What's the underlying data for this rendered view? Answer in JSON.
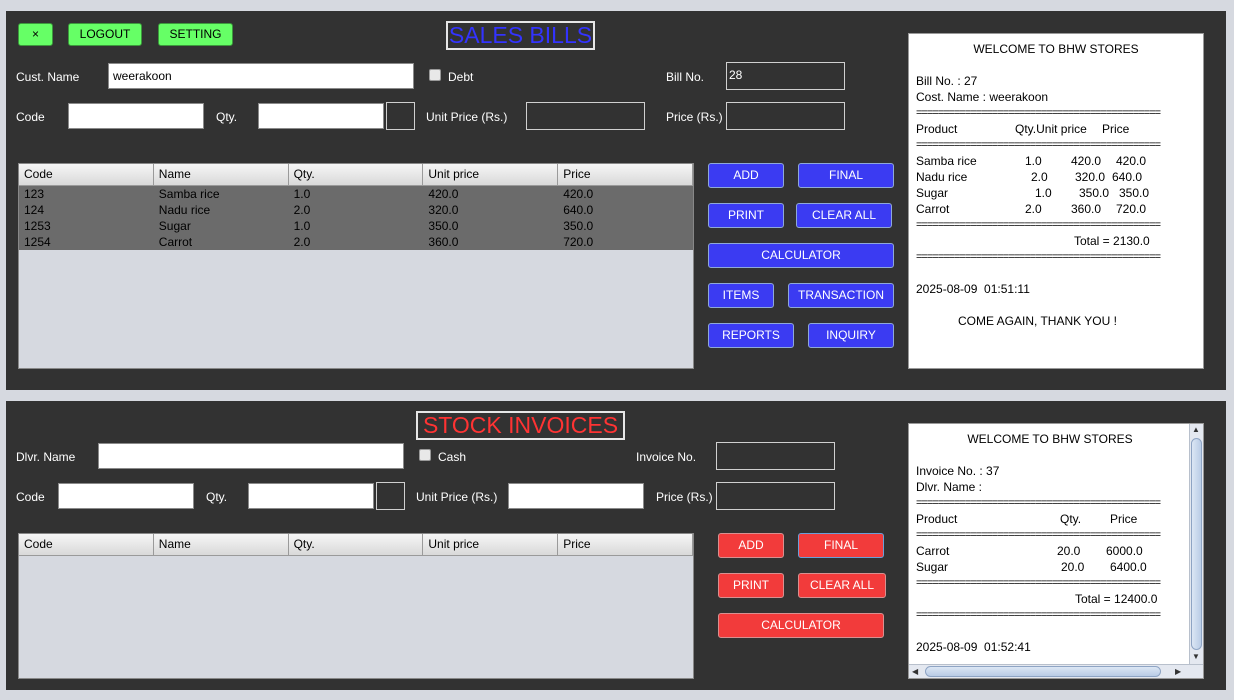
{
  "top_buttons": {
    "close": "×",
    "logout": "LOGOUT",
    "setting": "SETTING"
  },
  "sales": {
    "title": "SALES BILLS",
    "cust_name_label": "Cust. Name",
    "cust_name_value": "weerakoon",
    "debt_label": "Debt",
    "bill_no_label": "Bill No.",
    "bill_no_value": "28",
    "code_label": "Code",
    "qty_label": "Qty.",
    "unit_price_label": "Unit Price (Rs.)",
    "price_label": "Price (Rs.)",
    "table": {
      "headers": [
        "Code",
        "Name",
        "Qty.",
        "Unit price",
        "Price"
      ],
      "rows": [
        [
          "123",
          "Samba rice",
          "1.0",
          "420.0",
          "420.0"
        ],
        [
          "124",
          "Nadu rice",
          "2.0",
          "320.0",
          "640.0"
        ],
        [
          "1253",
          "Sugar",
          "1.0",
          "350.0",
          "350.0"
        ],
        [
          "1254",
          "Carrot",
          "2.0",
          "360.0",
          "720.0"
        ]
      ]
    },
    "buttons": {
      "add": "ADD",
      "final": "FINAL",
      "print": "PRINT",
      "clear_all": "CLEAR ALL",
      "calculator": "CALCULATOR",
      "items": "ITEMS",
      "transaction": "TRANSACTION",
      "reports": "REPORTS",
      "inquiry": "INQUIRY"
    },
    "receipt": {
      "welcome": "WELCOME TO BHW STORES",
      "bill_no": "Bill No. : 27",
      "cust_name": "Cost. Name : weerakoon",
      "separator": "=============================================",
      "col_product": "Product",
      "col_qty_unit": "Qty.Unit price",
      "col_price": "Price",
      "items": [
        {
          "name": "Samba rice",
          "qty": "1.0",
          "unit": "420.0",
          "price": "420.0"
        },
        {
          "name": "Nadu rice",
          "qty": "2.0",
          "unit": "320.0",
          "price": "640.0"
        },
        {
          "name": "Sugar",
          "qty": "1.0",
          "unit": "350.0",
          "price": "350.0"
        },
        {
          "name": "Carrot",
          "qty": "2.0",
          "unit": "360.0",
          "price": "720.0"
        }
      ],
      "total": "Total = 2130.0",
      "datetime": "2025-08-09  01:51:11",
      "thanks": "COME AGAIN, THANK YOU !"
    }
  },
  "stock": {
    "title": "STOCK INVOICES",
    "dlvr_name_label": "Dlvr. Name",
    "dlvr_name_value": "",
    "cash_label": "Cash",
    "invoice_no_label": "Invoice No.",
    "invoice_no_value": "",
    "code_label": "Code",
    "qty_label": "Qty.",
    "unit_price_label": "Unit Price (Rs.)",
    "price_label": "Price (Rs.)",
    "table": {
      "headers": [
        "Code",
        "Name",
        "Qty.",
        "Unit price",
        "Price"
      ]
    },
    "buttons": {
      "add": "ADD",
      "final": "FINAL",
      "print": "PRINT",
      "clear_all": "CLEAR ALL",
      "calculator": "CALCULATOR"
    },
    "receipt": {
      "welcome": "WELCOME TO BHW STORES",
      "invoice_no": "Invoice No. : 37",
      "dlvr_name": "Dlvr. Name :",
      "separator": "=============================================",
      "col_product": "Product",
      "col_qty": "Qty.",
      "col_price": "Price",
      "items": [
        {
          "name": "Carrot",
          "qty": "20.0",
          "price": "6000.0"
        },
        {
          "name": "Sugar",
          "qty": "20.0",
          "price": "6400.0"
        }
      ],
      "total": "Total = 12400.0",
      "datetime": "2025-08-09  01:52:41"
    }
  },
  "colors": {
    "panel_bg": "#323232",
    "sales_button": "#3b3bf2",
    "stock_button": "#f23b3b",
    "top_button": "#66ff66",
    "sales_title": "#3333ff",
    "stock_title": "#ff3333"
  }
}
